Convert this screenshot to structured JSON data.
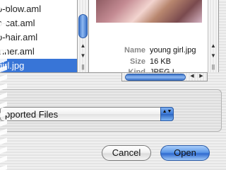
{
  "file_list": {
    "items": [
      {
        "label": "o-blow.aml",
        "selected": false
      },
      {
        "label": "o-cat.aml",
        "selected": false
      },
      {
        "label": "o-hair.aml",
        "selected": false
      },
      {
        "label": "inner.aml",
        "selected": false
      },
      {
        "label": "girl.jpg",
        "selected": true
      }
    ]
  },
  "preview": {
    "name_label": "Name",
    "name_value": "young girl.jpg",
    "size_label": "Size",
    "size_value": "16 KB",
    "kind_label": "Kind",
    "kind_value": "JPEG I"
  },
  "filter_popup": {
    "selected": "pported Files"
  },
  "buttons": {
    "cancel": "Cancel",
    "open": "Open"
  },
  "icons": {
    "up_arrow": "▲",
    "down_arrow": "▼",
    "left_arrow": "◀",
    "right_arrow": "▶",
    "popup_arrows": "▲▼",
    "resize_grip": "||"
  },
  "colors": {
    "selection": "#3875d7",
    "aqua_blue": "#3a72c8"
  }
}
